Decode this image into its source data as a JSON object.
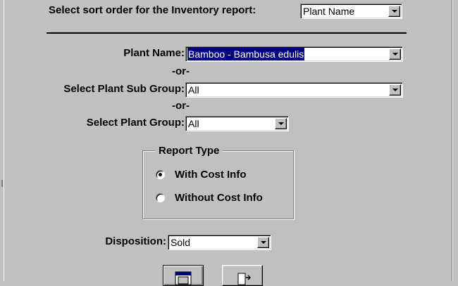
{
  "sort_order": {
    "label": "Select sort order for the Inventory report:",
    "value": "Plant Name"
  },
  "plant_name": {
    "label": "Plant Name:",
    "value": "Bamboo - Bambusa edulis"
  },
  "or_1": "-or-",
  "plant_sub_group": {
    "label": "Select Plant Sub Group:",
    "value": "All"
  },
  "or_2": "-or-",
  "plant_group": {
    "label": "Select Plant Group:",
    "value": "All"
  },
  "report_type": {
    "legend": "Report Type",
    "options": [
      {
        "label": "With Cost Info",
        "selected": true
      },
      {
        "label": "Without Cost Info",
        "selected": false
      }
    ]
  },
  "disposition": {
    "label": "Disposition:",
    "value": "Sold"
  },
  "toolbar": {
    "buttons": [
      {
        "icon": "print-preview-icon"
      },
      {
        "icon": "exit-icon"
      }
    ]
  },
  "colors": {
    "face": "#c0c0c0",
    "highlight": "#000080",
    "field": "#ffffff"
  }
}
